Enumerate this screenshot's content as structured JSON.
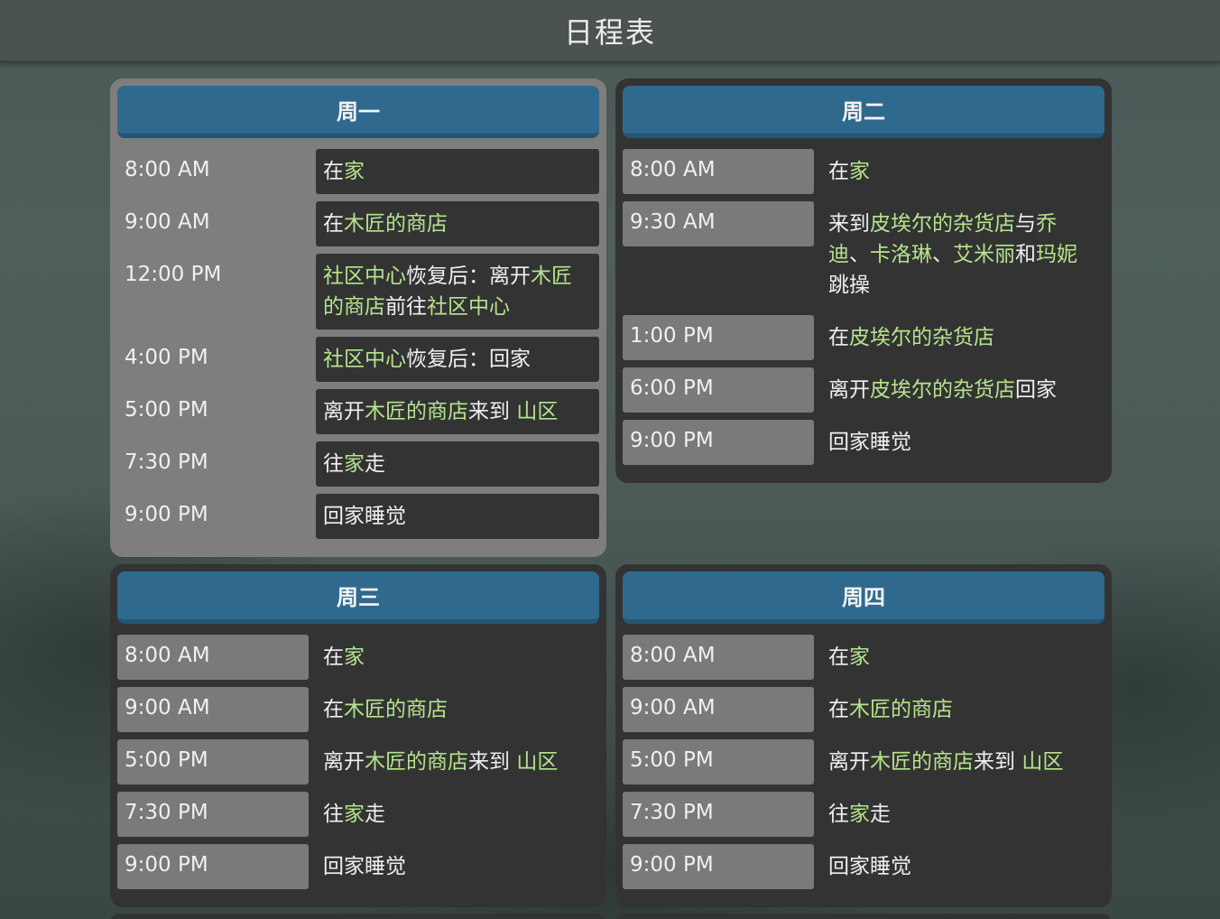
{
  "title": "日程表",
  "days": [
    {
      "label": "周一",
      "entries": [
        {
          "time": "8:00 AM",
          "parts": [
            [
              "在",
              0
            ],
            [
              "家",
              1
            ]
          ]
        },
        {
          "time": "9:00 AM",
          "parts": [
            [
              "在",
              0
            ],
            [
              "木匠的商店",
              1
            ]
          ]
        },
        {
          "time": "12:00 PM",
          "parts": [
            [
              "社区中心",
              1
            ],
            [
              "恢复后：离开",
              0
            ],
            [
              "木匠的商店",
              1
            ],
            [
              "前往",
              0
            ],
            [
              "社区中心",
              1
            ]
          ]
        },
        {
          "time": "4:00 PM",
          "parts": [
            [
              "社区中心",
              1
            ],
            [
              "恢复后：回家",
              0
            ]
          ]
        },
        {
          "time": "5:00 PM",
          "parts": [
            [
              "离开",
              0
            ],
            [
              "木匠的商店",
              1
            ],
            [
              "来到 ",
              0
            ],
            [
              "山区",
              1
            ]
          ]
        },
        {
          "time": "7:30 PM",
          "parts": [
            [
              "往",
              0
            ],
            [
              "家",
              1
            ],
            [
              "走",
              0
            ]
          ]
        },
        {
          "time": "9:00 PM",
          "parts": [
            [
              "回家睡觉",
              0
            ]
          ]
        }
      ]
    },
    {
      "label": "周二",
      "entries": [
        {
          "time": "8:00 AM",
          "parts": [
            [
              "在",
              0
            ],
            [
              "家",
              1
            ]
          ]
        },
        {
          "time": "9:30 AM",
          "parts": [
            [
              "来到",
              0
            ],
            [
              "皮埃尔的杂货店",
              1
            ],
            [
              "与",
              0
            ],
            [
              "乔迪",
              1
            ],
            [
              "、",
              0
            ],
            [
              "卡洛琳",
              1
            ],
            [
              "、",
              0
            ],
            [
              "艾米丽",
              1
            ],
            [
              "和",
              0
            ],
            [
              "玛妮",
              1
            ],
            [
              "跳操",
              0
            ]
          ]
        },
        {
          "time": "1:00 PM",
          "parts": [
            [
              "在",
              0
            ],
            [
              "皮埃尔的杂货店",
              1
            ]
          ]
        },
        {
          "time": "6:00 PM",
          "parts": [
            [
              "离开",
              0
            ],
            [
              "皮埃尔的杂货店",
              1
            ],
            [
              "回家",
              0
            ]
          ]
        },
        {
          "time": "9:00 PM",
          "parts": [
            [
              "回家睡觉",
              0
            ]
          ]
        }
      ]
    },
    {
      "label": "周三",
      "entries": [
        {
          "time": "8:00 AM",
          "parts": [
            [
              "在",
              0
            ],
            [
              "家",
              1
            ]
          ]
        },
        {
          "time": "9:00 AM",
          "parts": [
            [
              "在",
              0
            ],
            [
              "木匠的商店",
              1
            ]
          ]
        },
        {
          "time": "5:00 PM",
          "parts": [
            [
              "离开",
              0
            ],
            [
              "木匠的商店",
              1
            ],
            [
              "来到 ",
              0
            ],
            [
              "山区",
              1
            ]
          ]
        },
        {
          "time": "7:30 PM",
          "parts": [
            [
              "往",
              0
            ],
            [
              "家",
              1
            ],
            [
              "走",
              0
            ]
          ]
        },
        {
          "time": "9:00 PM",
          "parts": [
            [
              "回家睡觉",
              0
            ]
          ]
        }
      ]
    },
    {
      "label": "周四",
      "entries": [
        {
          "time": "8:00 AM",
          "parts": [
            [
              "在",
              0
            ],
            [
              "家",
              1
            ]
          ]
        },
        {
          "time": "9:00 AM",
          "parts": [
            [
              "在",
              0
            ],
            [
              "木匠的商店",
              1
            ]
          ]
        },
        {
          "time": "5:00 PM",
          "parts": [
            [
              "离开",
              0
            ],
            [
              "木匠的商店",
              1
            ],
            [
              "来到 ",
              0
            ],
            [
              "山区",
              1
            ]
          ]
        },
        {
          "time": "7:30 PM",
          "parts": [
            [
              "往",
              0
            ],
            [
              "家",
              1
            ],
            [
              "走",
              0
            ]
          ]
        },
        {
          "time": "9:00 PM",
          "parts": [
            [
              "回家睡觉",
              0
            ]
          ]
        }
      ]
    }
  ],
  "colors": {
    "place_highlight": "#b5e48c",
    "header_blue": "#2f6a8e",
    "active_card": "#807d7d",
    "card": "#333333"
  }
}
